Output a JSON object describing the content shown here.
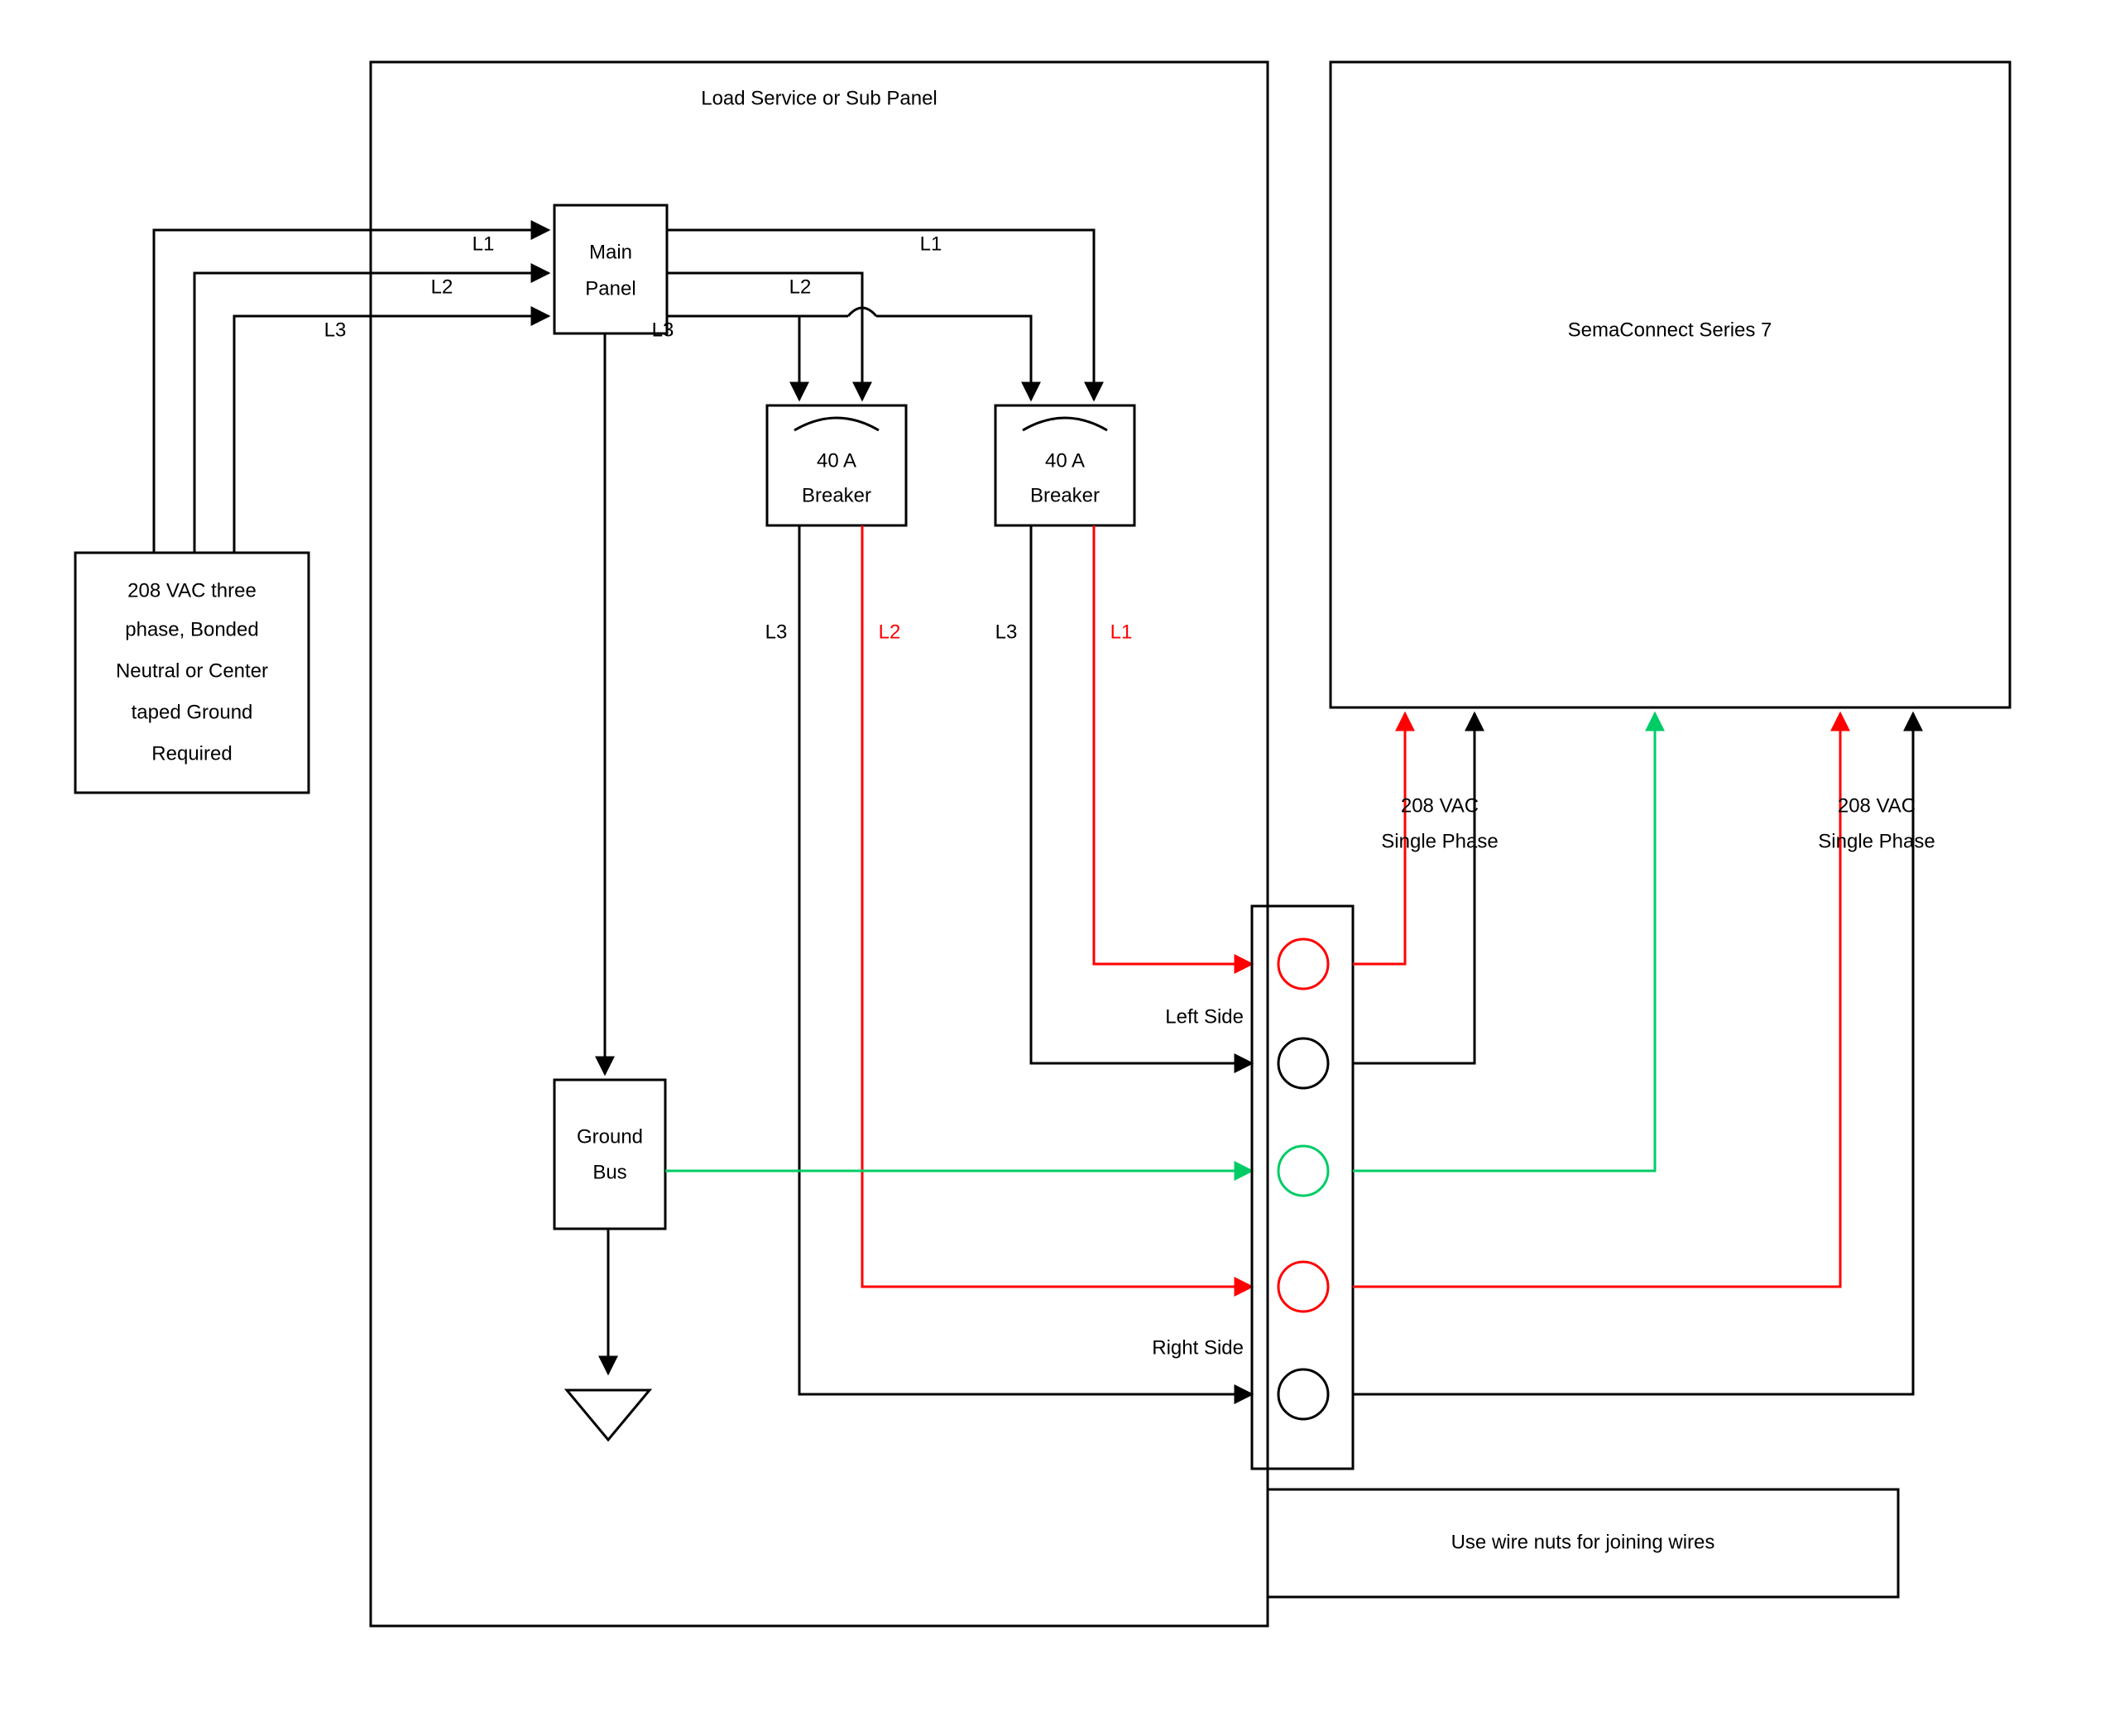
{
  "title_panel": "Load Service or Sub Panel",
  "source_box": {
    "l1": "208 VAC three",
    "l2": "phase, Bonded",
    "l3": "Neutral or Center",
    "l4": "taped Ground",
    "l5": "Required"
  },
  "main_panel": {
    "l1": "Main",
    "l2": "Panel"
  },
  "breaker1": {
    "l1": "40 A",
    "l2": "Breaker"
  },
  "breaker2": {
    "l1": "40 A",
    "l2": "Breaker"
  },
  "ground_bus": {
    "l1": "Ground",
    "l2": "Bus"
  },
  "lines": {
    "L1": "L1",
    "L2": "L2",
    "L3": "L3"
  },
  "left_side": "Left Side",
  "right_side": "Right Side",
  "sema": "SemaConnect Series 7",
  "phase_label": {
    "l1": "208 VAC",
    "l2": "Single Phase"
  },
  "wire_nuts": "Use wire nuts for joining wires",
  "colors": {
    "blk": "#000000",
    "red": "#ff0000",
    "grn": "#00cc66"
  }
}
